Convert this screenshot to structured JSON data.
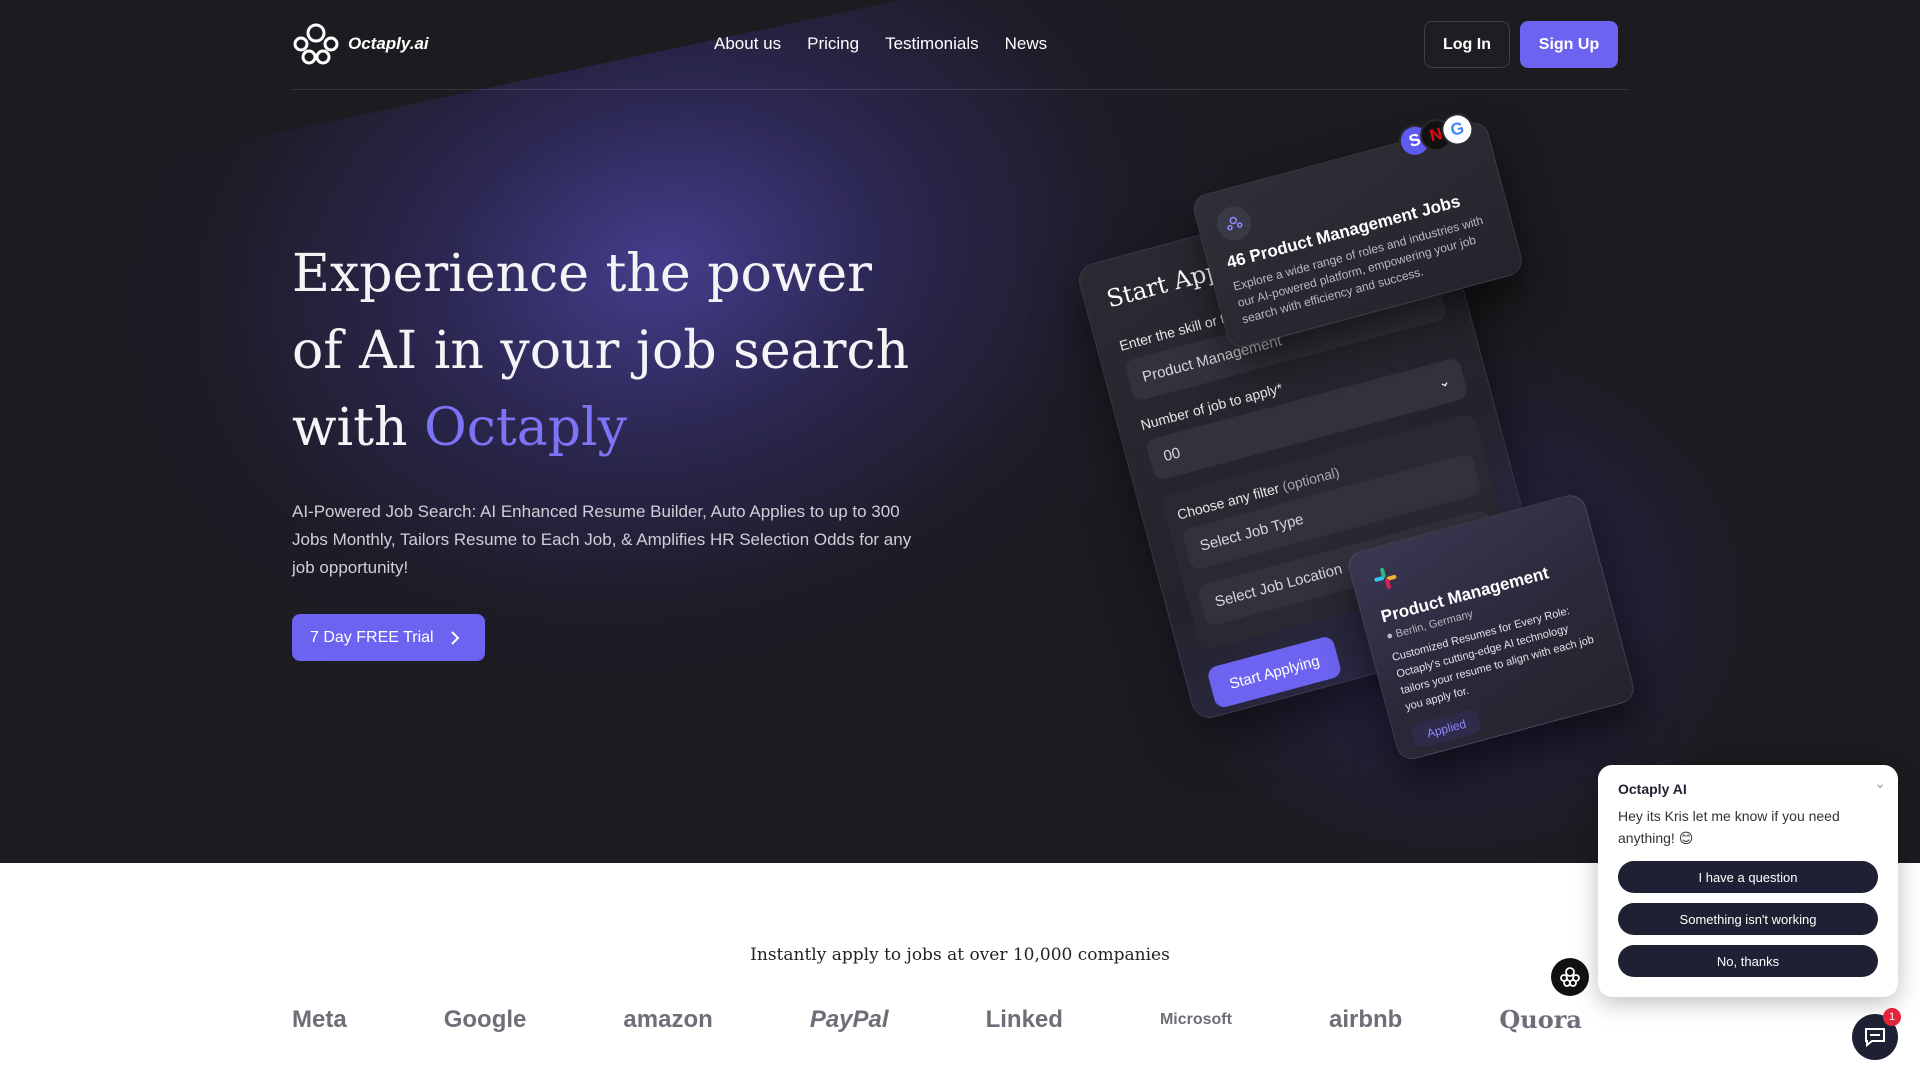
{
  "brand": {
    "name": "Octaply.ai",
    "accent": "#6c63f0"
  },
  "nav": {
    "links": [
      "About us",
      "Pricing",
      "Testimonials",
      "News"
    ],
    "login": "Log In",
    "signup": "Sign Up"
  },
  "hero": {
    "headline_part1": "Experience the power of AI in your job search with ",
    "headline_accent": "Octaply",
    "subtext": "AI-Powered Job Search: AI Enhanced Resume Builder, Auto Applies to up to 300 Jobs Monthly, Tailors Resume to Each Job, & Amplifies HR Selection Odds for any job opportunity!",
    "cta": "7 Day FREE Trial"
  },
  "form_card": {
    "title": "Start Applying",
    "skill_label": "Enter the skill or tags*",
    "skill_value": "Product Management",
    "count_label": "Number of job to apply*",
    "count_value": "00",
    "filter_label": "Choose any filter",
    "filter_optional": "(optional)",
    "job_type_placeholder": "Select Job Type",
    "job_location_placeholder": "Select Job Location",
    "submit": "Start Applying"
  },
  "jobs_card": {
    "title": "46 Product Management Jobs",
    "description": "Explore a wide range of roles and industries with our AI-powered platform, empowering your job search with efficiency and success."
  },
  "pm_card": {
    "title": "Product Management",
    "location": "Berlin, Germany",
    "description": "Customized Resumes for Every Role: Octaply's cutting-edge AI technology tailors your resume to align with each job you apply for.",
    "status": "Applied"
  },
  "companies": {
    "title": "Instantly apply to jobs at over 10,000 companies",
    "logos": [
      "Meta",
      "Google",
      "amazon",
      "PayPal",
      "Linked",
      "Microsoft",
      "airbnb",
      "Quora"
    ]
  },
  "chat": {
    "name": "Octaply AI",
    "message": "Hey its Kris let me know if you need anything! 😊",
    "options": [
      "I have a question",
      "Something isn't working",
      "No, thanks"
    ],
    "badge": "1"
  }
}
